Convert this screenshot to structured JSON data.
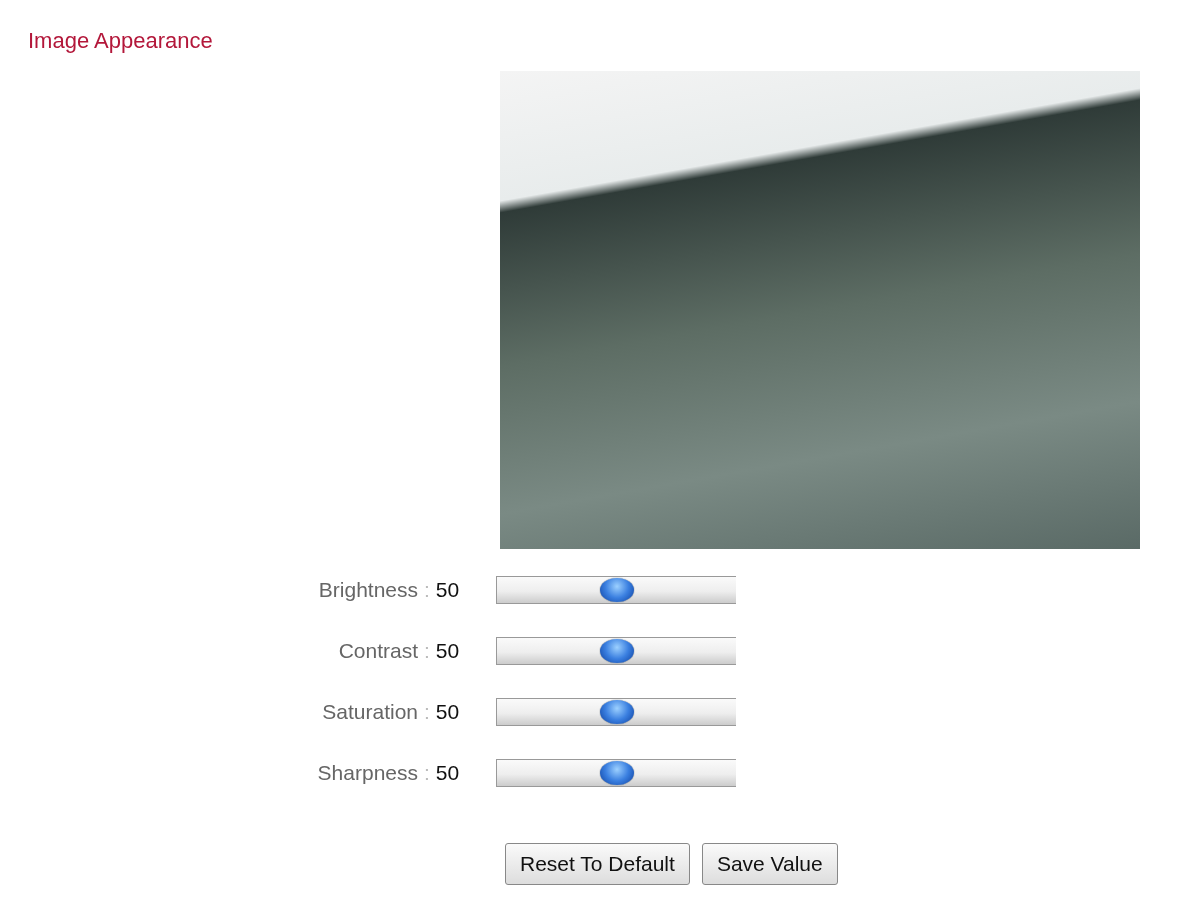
{
  "title": "Image Appearance",
  "preview": {
    "kind": "video"
  },
  "sliders": [
    {
      "label": "Brightness",
      "separator": ":",
      "value": "50",
      "level": 0.5
    },
    {
      "label": "Contrast",
      "separator": ":",
      "value": "50",
      "level": 0.5
    },
    {
      "label": "Saturation",
      "separator": ":",
      "value": "50",
      "level": 0.5
    },
    {
      "label": "Sharpness",
      "separator": ":",
      "value": "50",
      "level": 0.5
    }
  ],
  "buttons": [
    "Reset To Default",
    "Save Value"
  ]
}
